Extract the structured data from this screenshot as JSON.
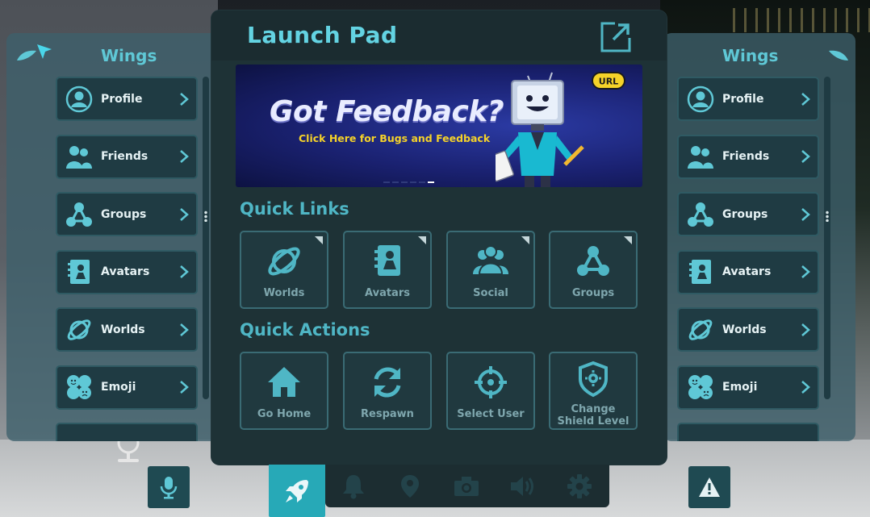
{
  "launch_pad": {
    "title": "Launch Pad",
    "banner": {
      "headline": "Got Feedback?",
      "subline": "Click Here for Bugs and Feedback",
      "badge": "URL",
      "slide_count": 6,
      "active_slide": 6
    },
    "quick_links": {
      "title": "Quick Links",
      "items": [
        {
          "label": "Worlds",
          "icon": "planet-icon"
        },
        {
          "label": "Avatars",
          "icon": "avatar-book-icon"
        },
        {
          "label": "Social",
          "icon": "people-icon"
        },
        {
          "label": "Groups",
          "icon": "groups-icon"
        }
      ]
    },
    "quick_actions": {
      "title": "Quick Actions",
      "items": [
        {
          "label": "Go Home",
          "icon": "home-icon"
        },
        {
          "label": "Respawn",
          "icon": "respawn-icon"
        },
        {
          "label": "Select User",
          "icon": "crosshair-icon"
        },
        {
          "label_line1": "Change",
          "label_line2": "Shield Level",
          "icon": "shield-icon"
        }
      ]
    }
  },
  "wing_left": {
    "title": "Wings",
    "items": [
      {
        "label": "Profile"
      },
      {
        "label": "Friends"
      },
      {
        "label": "Groups"
      },
      {
        "label": "Avatars"
      },
      {
        "label": "Worlds"
      },
      {
        "label": "Emoji"
      }
    ]
  },
  "wing_right": {
    "title": "Wings",
    "items": [
      {
        "label": "Profile"
      },
      {
        "label": "Friends"
      },
      {
        "label": "Groups"
      },
      {
        "label": "Avatars"
      },
      {
        "label": "Worlds"
      },
      {
        "label": "Emoji"
      }
    ]
  },
  "dock": {
    "buttons": [
      {
        "name": "rocket-icon",
        "active": true
      },
      {
        "name": "bell-icon",
        "active": false
      },
      {
        "name": "location-pin-icon",
        "active": false
      },
      {
        "name": "camera-icon",
        "active": false
      },
      {
        "name": "speaker-icon",
        "active": false
      },
      {
        "name": "gear-icon",
        "active": false
      }
    ]
  },
  "colors": {
    "accent": "#63d3e2",
    "panel": "#1e3236",
    "tile_border": "#3a6b74",
    "dock_active": "#27a9b7",
    "banner_text": "#f5d229"
  }
}
